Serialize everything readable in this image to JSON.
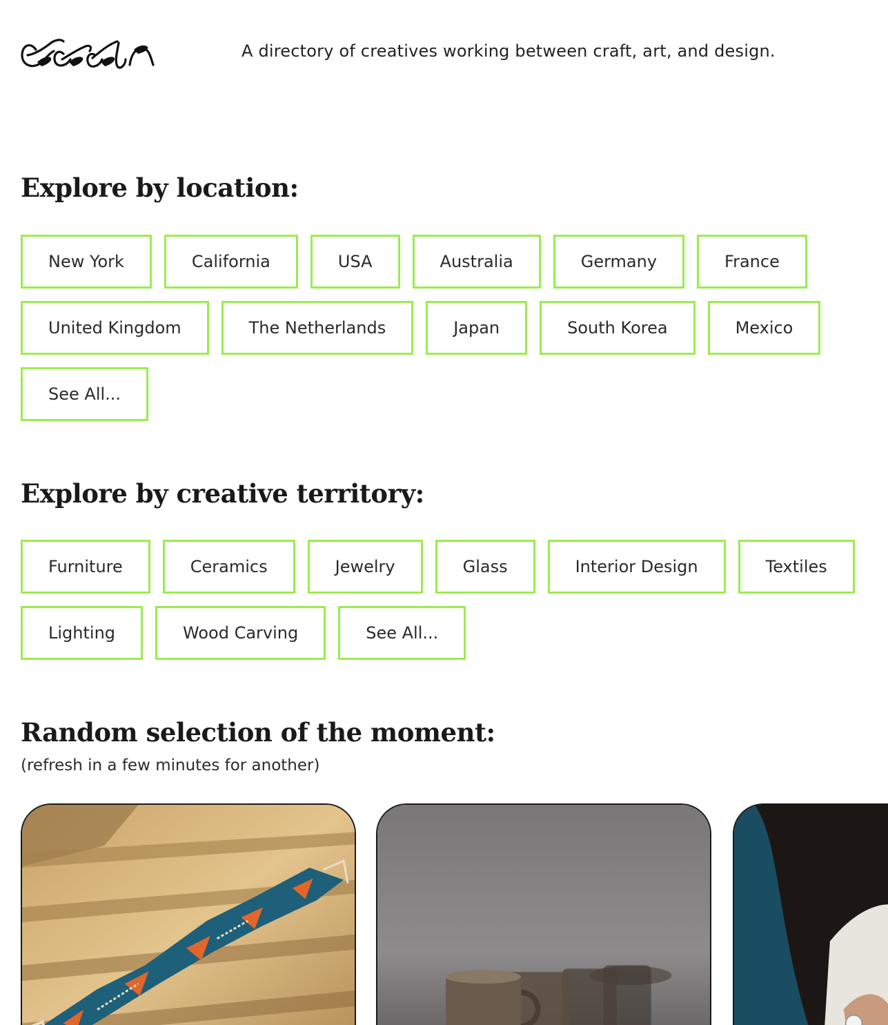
{
  "header": {
    "logo_text": "estih",
    "tagline": "A directory of creatives working between craft, art, and design."
  },
  "location": {
    "title": "Explore by location:",
    "items": [
      "New York",
      "California",
      "USA",
      "Australia",
      "Germany",
      "France",
      "United Kingdom",
      "The Netherlands",
      "Japan",
      "South Korea",
      "Mexico",
      "See All..."
    ]
  },
  "territory": {
    "title": "Explore by creative territory:",
    "items": [
      "Furniture",
      "Ceramics",
      "Jewelry",
      "Glass",
      "Interior Design",
      "Textiles",
      "Lighting",
      "Wood Carving",
      "See All..."
    ]
  },
  "random": {
    "title": "Random selection of the moment:",
    "subtitle": "(refresh in a few minutes for another)"
  },
  "colors": {
    "chip_border": "#9bec4e",
    "text": "#1c1c1c",
    "background": "#ffffff"
  },
  "icons": {
    "logo": "handwritten-wordmark"
  }
}
